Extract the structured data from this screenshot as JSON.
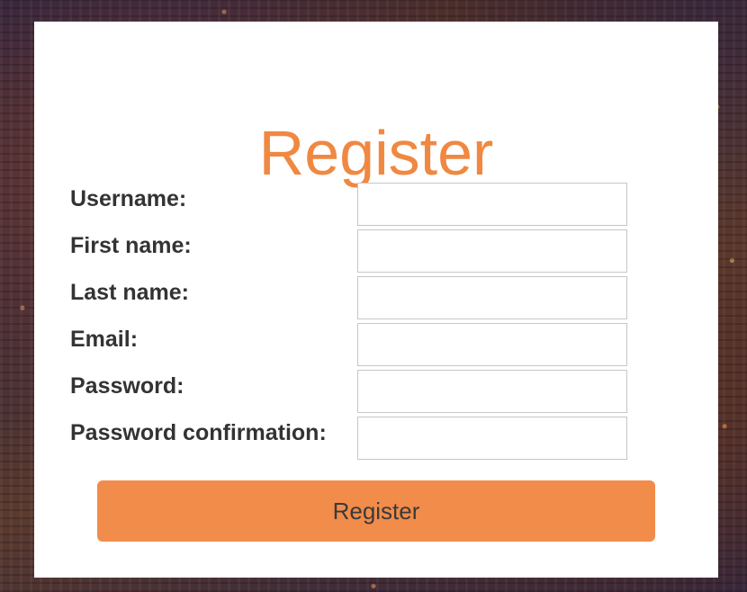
{
  "form": {
    "title": "Register",
    "fields": [
      {
        "label": "Username:",
        "value": ""
      },
      {
        "label": "First name:",
        "value": ""
      },
      {
        "label": "Last name:",
        "value": ""
      },
      {
        "label": "Email:",
        "value": ""
      },
      {
        "label": "Password:",
        "value": ""
      },
      {
        "label": "Password confirmation:",
        "value": ""
      }
    ],
    "submit_label": "Register"
  },
  "colors": {
    "accent": "#f08842",
    "button": "#f28c4a",
    "label_text": "#333333",
    "card": "#ffffff"
  }
}
